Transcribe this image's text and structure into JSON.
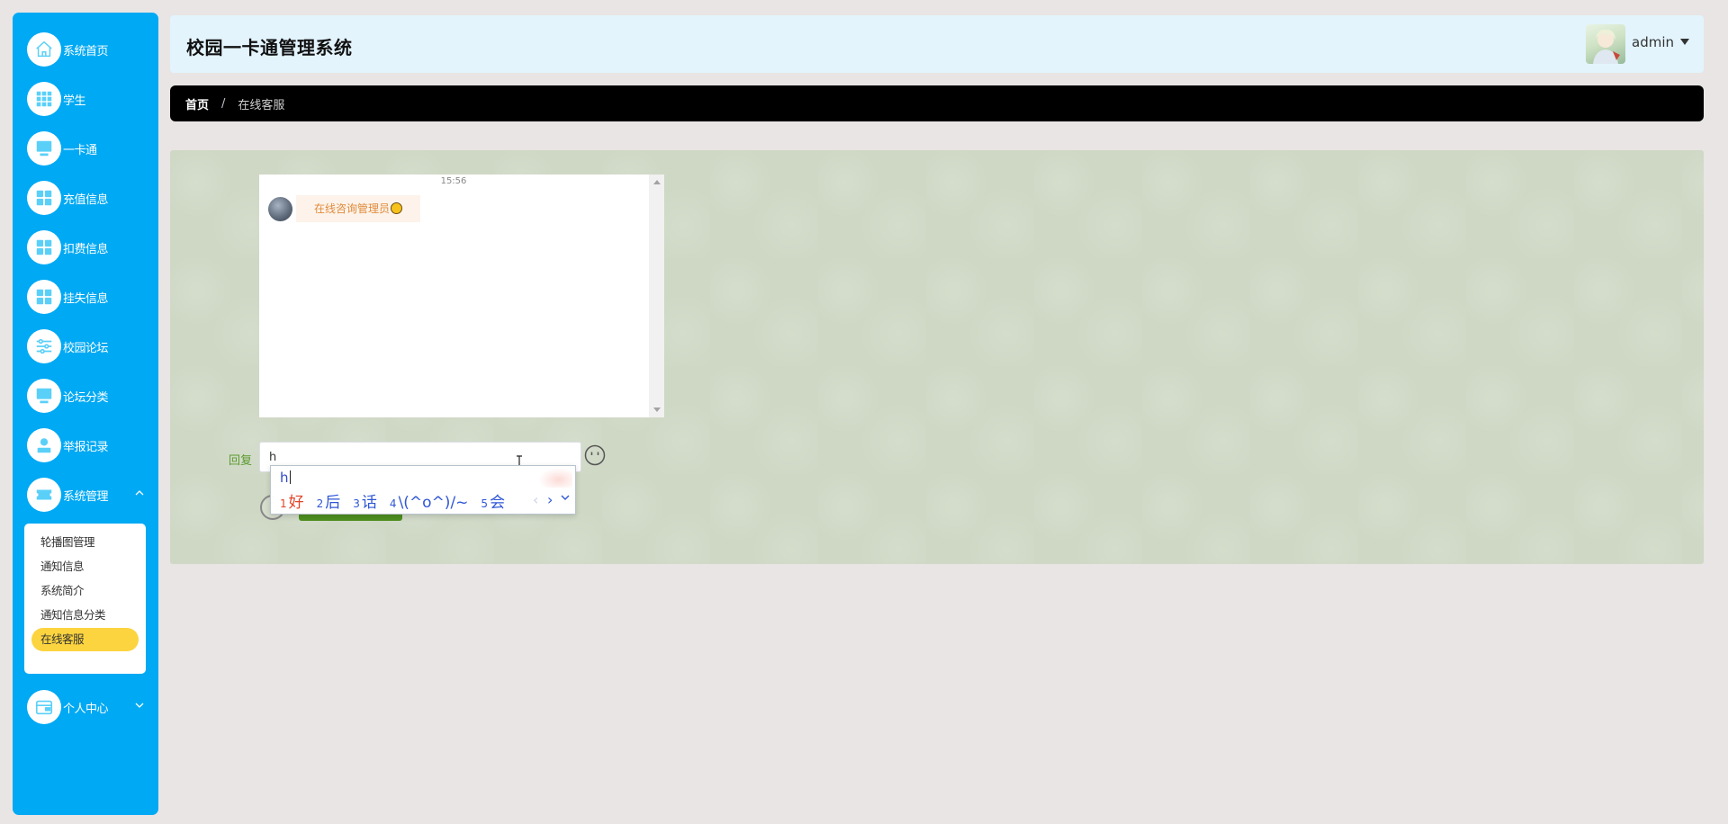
{
  "sidebar": {
    "items": [
      {
        "label": "系统首页",
        "icon": "home-icon"
      },
      {
        "label": "学生",
        "icon": "grid-icon"
      },
      {
        "label": "一卡通",
        "icon": "monitor-icon"
      },
      {
        "label": "充值信息",
        "icon": "apps-icon"
      },
      {
        "label": "扣费信息",
        "icon": "apps-icon"
      },
      {
        "label": "挂失信息",
        "icon": "apps-icon"
      },
      {
        "label": "校园论坛",
        "icon": "sliders-icon"
      },
      {
        "label": "论坛分类",
        "icon": "monitor-icon"
      },
      {
        "label": "举报记录",
        "icon": "user-icon"
      },
      {
        "label": "系统管理",
        "icon": "ticket-icon",
        "expanded": true
      },
      {
        "label": "个人中心",
        "icon": "wallet-icon",
        "expanded": false
      }
    ],
    "submenu": [
      {
        "label": "轮播图管理"
      },
      {
        "label": "通知信息"
      },
      {
        "label": "系统简介"
      },
      {
        "label": "通知信息分类"
      },
      {
        "label": "在线客服",
        "active": true
      }
    ]
  },
  "header": {
    "title": "校园一卡通管理系统",
    "user": "admin"
  },
  "breadcrumb": {
    "home": "首页",
    "separator": "/",
    "current": "在线客服"
  },
  "chat": {
    "time": "15:56",
    "messages": [
      {
        "text": "在线咨询管理员"
      }
    ],
    "reply_label": "回复",
    "reply_value": "h"
  },
  "ime": {
    "pinyin": "h",
    "candidates": [
      {
        "num": "1",
        "text": "好"
      },
      {
        "num": "2",
        "text": "后"
      },
      {
        "num": "3",
        "text": "话"
      },
      {
        "num": "4",
        "text": "\\(^o^)/~"
      },
      {
        "num": "5",
        "text": "会"
      }
    ],
    "prev": "‹",
    "next": "›"
  },
  "colors": {
    "sidebar_bg": "#00a9f4",
    "active_submenu": "#fcd43f",
    "header_bg": "#e3f4fd",
    "breadcrumb_bg": "#000000",
    "panel_bg": "#cfd8c5",
    "send_button": "#4e8f1f",
    "reply_label": "#5b9a2e",
    "bubble_text": "#e08b3c"
  }
}
